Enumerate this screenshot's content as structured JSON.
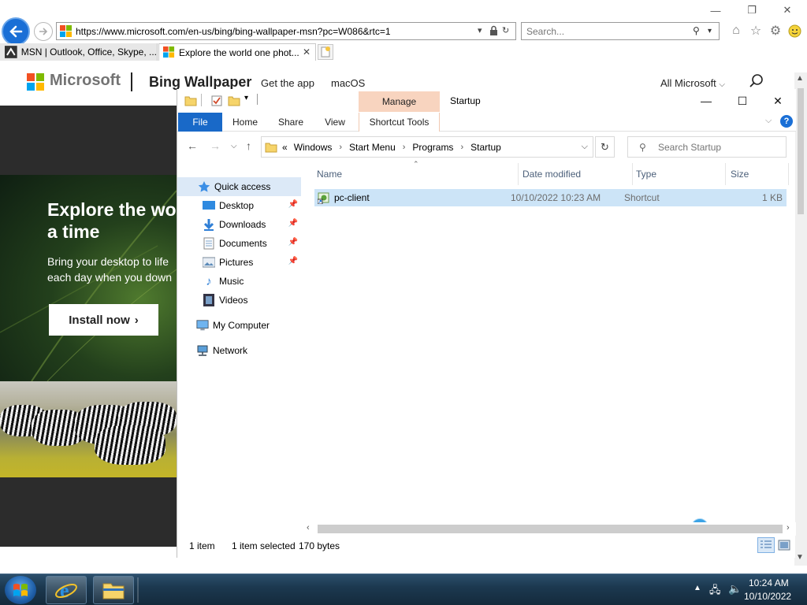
{
  "browser": {
    "url": "https://www.microsoft.com/en-us/bing/bing-wallpaper-msn?pc=W086&rtc=1",
    "search_placeholder": "Search...",
    "tabs": [
      {
        "title": "MSN | Outlook, Office, Skype, ..."
      },
      {
        "title": "Explore the world one phot..."
      }
    ]
  },
  "webpage": {
    "brand": "Microsoft",
    "product": "Bing Wallpaper",
    "nav": [
      "Get the app",
      "macOS"
    ],
    "all_microsoft": "All Microsoft",
    "hero_title_line1": "Explore the wor",
    "hero_title_line2": "a time",
    "hero_sub_line1": "Bring your desktop to life",
    "hero_sub_line2": "each day when you down",
    "install_label": "Install now"
  },
  "explorer": {
    "title": "Startup",
    "context_tab": "Manage",
    "ribbon_tabs": [
      "File",
      "Home",
      "Share",
      "View",
      "Shortcut Tools"
    ],
    "breadcrumb": [
      "Windows",
      "Start Menu",
      "Programs",
      "Startup"
    ],
    "breadcrumb_overflow": "«",
    "search_placeholder": "Search Startup",
    "columns": [
      "Name",
      "Date modified",
      "Type",
      "Size"
    ],
    "files": [
      {
        "name": "pc-client",
        "date": "10/10/2022 10:23 AM",
        "type": "Shortcut",
        "size": "1 KB"
      }
    ],
    "nav_pane": {
      "quick_access": "Quick access",
      "quick_items": [
        "Desktop",
        "Downloads",
        "Documents",
        "Pictures",
        "Music",
        "Videos"
      ],
      "my_computer": "My Computer",
      "network": "Network"
    },
    "status": {
      "count": "1 item",
      "selected": "1 item selected",
      "size": "170 bytes"
    }
  },
  "taskbar": {
    "time": "10:24 AM",
    "date": "10/10/2022"
  },
  "colors": {
    "file_tab": "#1969c8",
    "manage_tab": "#f8d4bf",
    "selection": "#cce4f7",
    "taskbar": "#1c3950"
  }
}
